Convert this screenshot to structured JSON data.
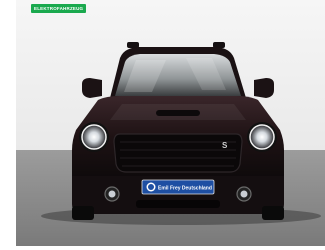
{
  "badge": {
    "label": "ELEKTROFAHRZEUG"
  },
  "license_plate": {
    "text": "Emil Frey Deutschland"
  },
  "colors": {
    "badge_green": "#1aa94e",
    "plate_blue": "#1e4fa3",
    "car_body": "#1e1214",
    "floor": "#8e8e8e"
  },
  "icons": {
    "car": "car-photo",
    "logo": "emil-frey-emblem-icon"
  }
}
